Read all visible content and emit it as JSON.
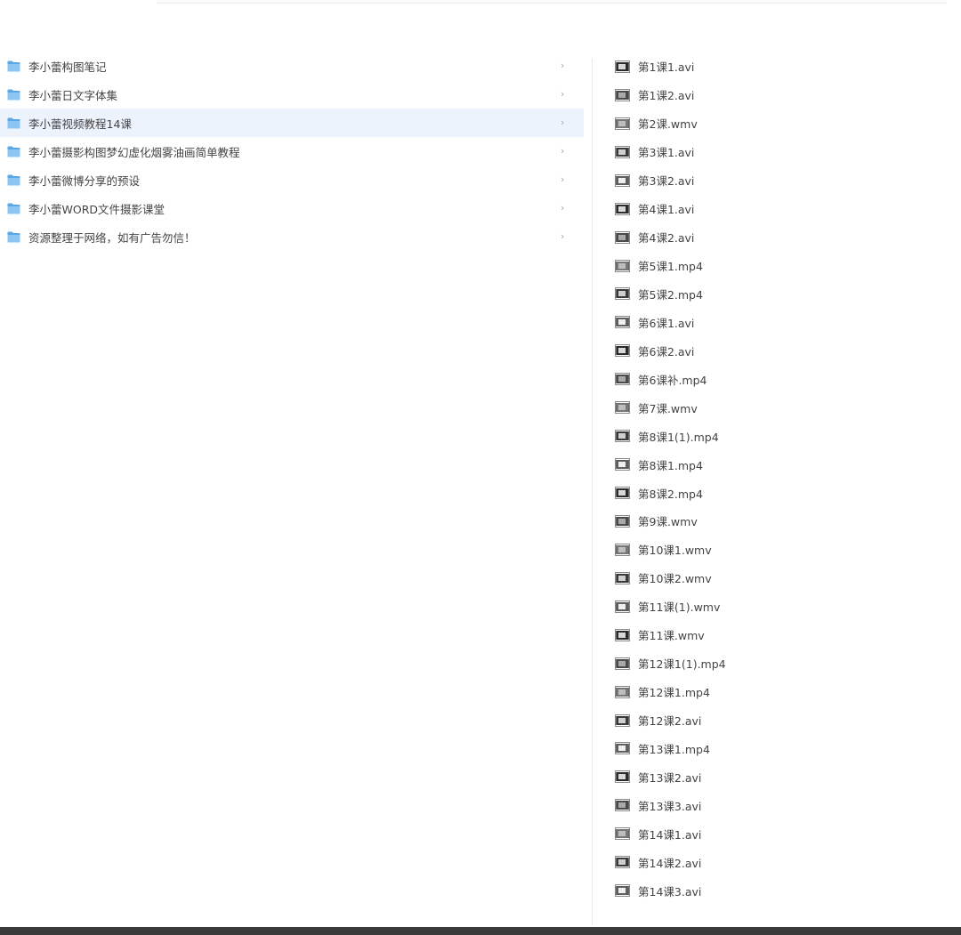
{
  "folders": [
    {
      "label": "李小蕾构图笔记",
      "selected": false,
      "icon": "folder-icon"
    },
    {
      "label": "李小蕾日文字体集",
      "selected": false,
      "icon": "folder-icon"
    },
    {
      "label": "李小蕾视频教程14课",
      "selected": true,
      "icon": "folder-icon"
    },
    {
      "label": "李小蕾摄影构图梦幻虚化烟雾油画简单教程",
      "selected": false,
      "icon": "folder-icon"
    },
    {
      "label": "李小蕾微博分享的预设",
      "selected": false,
      "icon": "folder-icon"
    },
    {
      "label": "李小蕾WORD文件摄影课堂",
      "selected": false,
      "icon": "folder-icon"
    },
    {
      "label": "资源整理于网络，如有广告勿信！",
      "selected": false,
      "icon": "folder-icon"
    }
  ],
  "chevron_glyph": "›",
  "files": [
    {
      "label": "第1课1.avi",
      "icon": "video-thumbnail-icon"
    },
    {
      "label": "第1课2.avi",
      "icon": "video-thumbnail-icon"
    },
    {
      "label": "第2课.wmv",
      "icon": "video-thumbnail-icon"
    },
    {
      "label": "第3课1.avi",
      "icon": "video-thumbnail-icon"
    },
    {
      "label": "第3课2.avi",
      "icon": "video-thumbnail-icon"
    },
    {
      "label": "第4课1.avi",
      "icon": "video-thumbnail-icon"
    },
    {
      "label": "第4课2.avi",
      "icon": "video-thumbnail-icon"
    },
    {
      "label": "第5课1.mp4",
      "icon": "video-thumbnail-icon"
    },
    {
      "label": "第5课2.mp4",
      "icon": "video-thumbnail-icon"
    },
    {
      "label": "第6课1.avi",
      "icon": "video-thumbnail-icon"
    },
    {
      "label": "第6课2.avi",
      "icon": "video-thumbnail-icon"
    },
    {
      "label": "第6课补.mp4",
      "icon": "video-thumbnail-icon"
    },
    {
      "label": "第7课.wmv",
      "icon": "video-thumbnail-icon"
    },
    {
      "label": "第8课1(1).mp4",
      "icon": "video-thumbnail-icon"
    },
    {
      "label": "第8课1.mp4",
      "icon": "video-thumbnail-icon"
    },
    {
      "label": "第8课2.mp4",
      "icon": "video-thumbnail-icon"
    },
    {
      "label": "第9课.wmv",
      "icon": "video-thumbnail-icon"
    },
    {
      "label": "第10课1.wmv",
      "icon": "video-thumbnail-icon"
    },
    {
      "label": "第10课2.wmv",
      "icon": "video-thumbnail-icon"
    },
    {
      "label": "第11课(1).wmv",
      "icon": "video-thumbnail-icon"
    },
    {
      "label": "第11课.wmv",
      "icon": "video-thumbnail-icon"
    },
    {
      "label": "第12课1(1).mp4",
      "icon": "video-thumbnail-icon"
    },
    {
      "label": "第12课1.mp4",
      "icon": "video-thumbnail-icon"
    },
    {
      "label": "第12课2.avi",
      "icon": "video-thumbnail-icon"
    },
    {
      "label": "第13课1.mp4",
      "icon": "video-thumbnail-icon"
    },
    {
      "label": "第13课2.avi",
      "icon": "video-thumbnail-icon"
    },
    {
      "label": "第13课3.avi",
      "icon": "video-thumbnail-icon"
    },
    {
      "label": "第14课1.avi",
      "icon": "video-thumbnail-icon"
    },
    {
      "label": "第14课2.avi",
      "icon": "video-thumbnail-icon"
    },
    {
      "label": "第14课3.avi",
      "icon": "video-thumbnail-icon"
    }
  ],
  "colors": {
    "selected_row": "#edf3fd",
    "folder_blue": "#5aa7e8",
    "folder_blue_light": "#8cc5f2",
    "text": "#444444",
    "chevron": "#aaaaaa",
    "bottom_bar": "#3a3a3a"
  }
}
